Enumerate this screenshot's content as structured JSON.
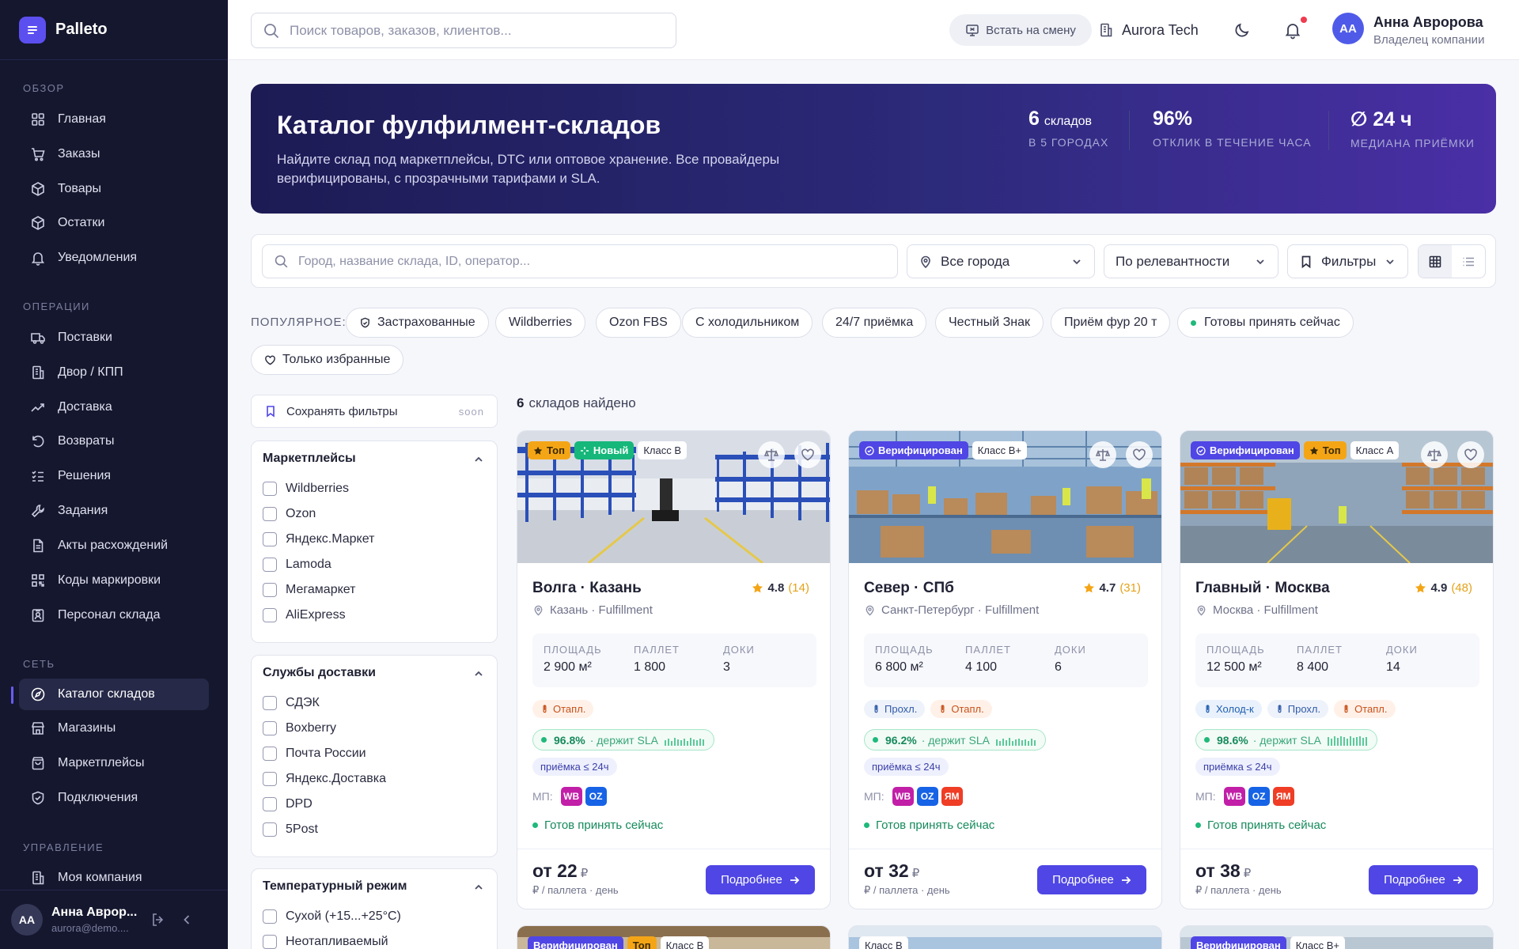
{
  "brand": {
    "name": "Palleto"
  },
  "sidebar": {
    "sections": [
      {
        "title": "ОБЗОР"
      },
      {
        "title": "ОПЕРАЦИИ"
      },
      {
        "title": "СЕТЬ"
      },
      {
        "title": "УПРАВЛЕНИЕ"
      }
    ],
    "items": [
      {
        "label": "Главная",
        "icon": "grid-icon"
      },
      {
        "label": "Заказы",
        "icon": "cart-icon"
      },
      {
        "label": "Товары",
        "icon": "box-icon"
      },
      {
        "label": "Остатки",
        "icon": "box-icon"
      },
      {
        "label": "Уведомления",
        "icon": "bell-icon"
      },
      {
        "label": "Поставки",
        "icon": "truck-icon"
      },
      {
        "label": "Двор / КПП",
        "icon": "building-icon"
      },
      {
        "label": "Доставка",
        "icon": "trend-icon"
      },
      {
        "label": "Возвраты",
        "icon": "return-icon"
      },
      {
        "label": "Решения",
        "icon": "checklist-icon"
      },
      {
        "label": "Задания",
        "icon": "wrench-icon"
      },
      {
        "label": "Акты расхождений",
        "icon": "document-icon"
      },
      {
        "label": "Коды маркировки",
        "icon": "qr-icon"
      },
      {
        "label": "Персонал склада",
        "icon": "badge-icon"
      },
      {
        "label": "Каталог складов",
        "icon": "compass-icon"
      },
      {
        "label": "Магазины",
        "icon": "store-icon"
      },
      {
        "label": "Маркетплейсы",
        "icon": "bag-icon"
      },
      {
        "label": "Подключения",
        "icon": "shield-icon"
      },
      {
        "label": "Моя компания",
        "icon": "building-icon"
      }
    ],
    "active": "Каталог складов",
    "user": {
      "initials": "AA",
      "name": "Анна Аврор...",
      "email": "aurora@demo...."
    }
  },
  "topbar": {
    "search_placeholder": "Поиск товаров, заказов, клиентов...",
    "shift_label": "Встать на смену",
    "company": "Aurora Tech",
    "user": {
      "initials": "AA",
      "name": "Анна Авророва",
      "role": "Владелец компании"
    }
  },
  "hero": {
    "title": "Каталог фулфилмент-складов",
    "subtitle": "Найдите склад под маркетплейсы, DTC или оптовое хранение. Все провайдеры верифицированы, с прозрачными тарифами и SLA.",
    "stats": [
      {
        "value": "6",
        "unit": "складов",
        "label": "В 5 ГОРОДАХ"
      },
      {
        "value": "96%",
        "unit": "",
        "label": "ОТКЛИК В ТЕЧЕНИЕ ЧАСА"
      },
      {
        "value": "∅ 24 ч",
        "unit": "",
        "label": "МЕДИАНА ПРИЁМКИ"
      }
    ]
  },
  "filters": {
    "search_placeholder": "Город, название склада, ID, оператор...",
    "city": "Все города",
    "sort": "По релевантности",
    "filters_label": "Фильтры"
  },
  "popular": {
    "label": "ПОПУЛЯРНОЕ:",
    "chips": [
      "Застрахованные",
      "Wildberries",
      "Ozon FBS",
      "С холодильником",
      "24/7 приёмка",
      "Честный Знак",
      "Приём фур 20 т",
      "Готовы принять сейчас",
      "Только избранные"
    ]
  },
  "side_filters": {
    "save_label": "Сохранять фильтры",
    "soon": "soon",
    "groups": [
      {
        "title": "Маркетплейсы",
        "options": [
          "Wildberries",
          "Ozon",
          "Яндекс.Маркет",
          "Lamoda",
          "Мегамаркет",
          "AliExpress"
        ]
      },
      {
        "title": "Службы доставки",
        "options": [
          "СДЭК",
          "Boxberry",
          "Почта России",
          "Яндекс.Доставка",
          "DPD",
          "5Post"
        ]
      },
      {
        "title": "Температурный режим",
        "options": [
          "Сухой (+15...+25°C)",
          "Неотапливаемый"
        ]
      }
    ]
  },
  "results": {
    "count": "6",
    "label": "складов найдено"
  },
  "cards": [
    {
      "badges": [
        {
          "kind": "top",
          "label": "Топ"
        },
        {
          "kind": "new",
          "label": "Новый"
        },
        {
          "kind": "class",
          "label": "Класс B"
        }
      ],
      "title": "Волга · Казань",
      "rating": "4.8",
      "reviews": "(14)",
      "location": "Казань · Fulfillment",
      "stats": [
        {
          "label": "ПЛОЩАДЬ",
          "value": "2 900 м²"
        },
        {
          "label": "ПАЛЛЕТ",
          "value": "1 800"
        },
        {
          "label": "ДОКИ",
          "value": "3"
        }
      ],
      "tags": [
        {
          "kind": "heat",
          "label": "Отапл."
        }
      ],
      "sla_value": "96.8%",
      "sla_text": "· держит SLA",
      "acceptance": "приёмка ≤ 24ч",
      "mp_label": "МП:",
      "marketplaces": [
        "WB",
        "OZ"
      ],
      "status": "Готов принять сейчас",
      "price": "от 22",
      "currency": "₽",
      "price_unit": "₽ / паллета · день",
      "cta": "Подробнее"
    },
    {
      "badges": [
        {
          "kind": "ver",
          "label": "Верифицирован"
        },
        {
          "kind": "class",
          "label": "Класс B+"
        }
      ],
      "title": "Север · СПб",
      "rating": "4.7",
      "reviews": "(31)",
      "location": "Санкт-Петербург · Fulfillment",
      "stats": [
        {
          "label": "ПЛОЩАДЬ",
          "value": "6 800 м²"
        },
        {
          "label": "ПАЛЛЕТ",
          "value": "4 100"
        },
        {
          "label": "ДОКИ",
          "value": "6"
        }
      ],
      "tags": [
        {
          "kind": "pass",
          "label": "Прохл."
        },
        {
          "kind": "heat",
          "label": "Отапл."
        }
      ],
      "sla_value": "96.2%",
      "sla_text": "· держит SLA",
      "acceptance": "приёмка ≤ 24ч",
      "mp_label": "МП:",
      "marketplaces": [
        "WB",
        "OZ",
        "ЯМ"
      ],
      "status": "Готов принять сейчас",
      "price": "от 32",
      "currency": "₽",
      "price_unit": "₽ / паллета · день",
      "cta": "Подробнее"
    },
    {
      "badges": [
        {
          "kind": "ver",
          "label": "Верифицирован"
        },
        {
          "kind": "top",
          "label": "Топ"
        },
        {
          "kind": "class",
          "label": "Класс A"
        }
      ],
      "title": "Главный · Москва",
      "rating": "4.9",
      "reviews": "(48)",
      "location": "Москва · Fulfillment",
      "stats": [
        {
          "label": "ПЛОЩАДЬ",
          "value": "12 500 м²"
        },
        {
          "label": "ПАЛЛЕТ",
          "value": "8 400"
        },
        {
          "label": "ДОКИ",
          "value": "14"
        }
      ],
      "tags": [
        {
          "kind": "cold",
          "label": "Холод-к"
        },
        {
          "kind": "pass",
          "label": "Прохл."
        },
        {
          "kind": "heat",
          "label": "Отапл."
        }
      ],
      "sla_value": "98.6%",
      "sla_text": "· держит SLA",
      "acceptance": "приёмка ≤ 24ч",
      "mp_label": "МП:",
      "marketplaces": [
        "WB",
        "OZ",
        "ЯМ"
      ],
      "status": "Готов принять сейчас",
      "price": "от 38",
      "currency": "₽",
      "price_unit": "₽ / паллета · день",
      "cta": "Подробнее"
    }
  ],
  "next_cards": [
    {
      "badges": [
        "Верифицирован",
        "Топ",
        "Класс B"
      ]
    },
    {
      "badges": [
        "Класс B"
      ]
    },
    {
      "badges": [
        "Верифицирован",
        "Класс B+"
      ]
    }
  ],
  "colors": {
    "accent": "#4f46e5",
    "sidebar": "#15172e",
    "success": "#1fb97a",
    "star": "#f4a516"
  }
}
